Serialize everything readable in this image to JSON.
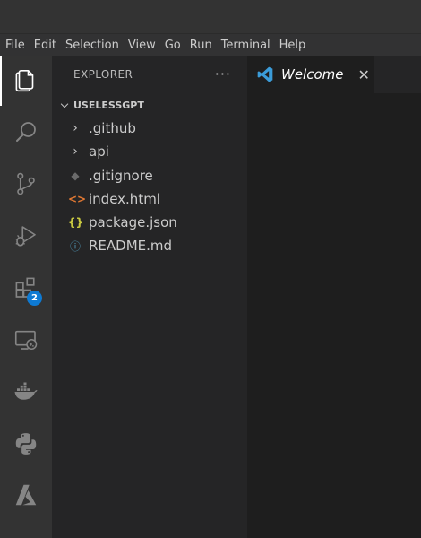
{
  "menubar": {
    "items": [
      "File",
      "Edit",
      "Selection",
      "View",
      "Go",
      "Run",
      "Terminal",
      "Help"
    ]
  },
  "activity_bar": {
    "items": [
      {
        "icon": "explorer-icon",
        "active": true
      },
      {
        "icon": "search-icon"
      },
      {
        "icon": "source-control-icon"
      },
      {
        "icon": "run-debug-icon"
      },
      {
        "icon": "extensions-icon",
        "badge": "2"
      },
      {
        "icon": "remote-explorer-icon"
      },
      {
        "icon": "docker-icon"
      },
      {
        "icon": "python-icon"
      },
      {
        "icon": "azure-icon"
      }
    ]
  },
  "explorer": {
    "title": "EXPLORER",
    "more": "···",
    "folder": "USELESSGPT",
    "items": [
      {
        "label": ".github",
        "icon": "chevron-right-icon"
      },
      {
        "label": "api",
        "icon": "chevron-right-icon"
      },
      {
        "label": ".gitignore",
        "icon": "git-icon"
      },
      {
        "label": "index.html",
        "icon": "html-icon"
      },
      {
        "label": "package.json",
        "icon": "json-icon"
      },
      {
        "label": "README.md",
        "icon": "info-icon"
      }
    ]
  },
  "editor": {
    "tab_label": "Welcome",
    "tab_close": "✕"
  },
  "colors": {
    "accent": "#0e7ad3",
    "html": "#e37933",
    "json": "#cbcb41",
    "info": "#519aba"
  }
}
